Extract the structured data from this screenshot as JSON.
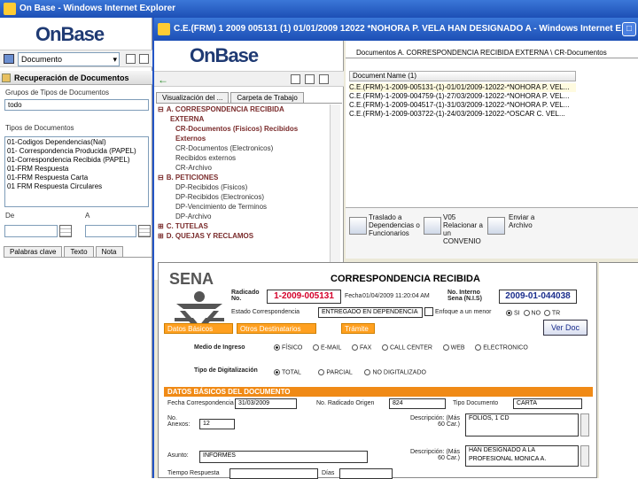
{
  "outer_window": {
    "title": "On Base - Windows Internet Explorer",
    "logo": "OnBase",
    "document_combo": "Documento",
    "panel_title": "Recuperación de Documentos",
    "groups_label": "Grupos de Tipos de Documentos",
    "groups_value": "todo",
    "types_label": "Tipos de Documentos",
    "types": [
      "01-Codigos Dependencias(Nal)",
      "01- Correspondencia Producida (PAPEL)",
      "01-Correspondencia Recibida (PAPEL)",
      "01-FRM Respuesta",
      "01-FRM Respuesta Carta",
      "01 FRM Respuesta Circulares"
    ],
    "date_from_label": "De",
    "date_to_label": "A",
    "tabs": [
      "Palabras clave",
      "Texto",
      "Nota"
    ]
  },
  "inner_window": {
    "title": "C.E.(FRM) 1 2009 005131 (1) 01/01/2009 12022 *NOHORA P. VELA HAN DESIGNADO A - Windows Internet E...",
    "logo": "OnBase",
    "nav_tabs": [
      "Visualización del ...",
      "Carpeta de Trabajo"
    ],
    "tree": [
      {
        "text": "A. CORRESPONDENCIA RECIBIDA",
        "bold": true,
        "toggle": "⊟"
      },
      {
        "text": "EXTERNA",
        "bold": true,
        "toggle": ""
      },
      {
        "text": "CR-Documentos (Fisicos) Recibidos",
        "bold": true,
        "toggle": "",
        "indent": 2
      },
      {
        "text": "Externos",
        "bold": true,
        "toggle": "",
        "indent": 2
      },
      {
        "text": "CR-Documentos (Electronicos)",
        "bold": false,
        "toggle": "",
        "indent": 2
      },
      {
        "text": "Recibidos externos",
        "bold": false,
        "toggle": "",
        "indent": 2
      },
      {
        "text": "CR-Archivo",
        "bold": false,
        "toggle": "",
        "indent": 2
      },
      {
        "text": "B. PETICIONES",
        "bold": true,
        "toggle": "⊟"
      },
      {
        "text": "DP-Recibidos (Fisicos)",
        "bold": false,
        "toggle": "",
        "indent": 2
      },
      {
        "text": "DP-Recibidos (Electronicos)",
        "bold": false,
        "toggle": "",
        "indent": 2
      },
      {
        "text": "DP-Vencimiento de Terminos",
        "bold": false,
        "toggle": "",
        "indent": 2
      },
      {
        "text": "DP-Archivo",
        "bold": false,
        "toggle": "",
        "indent": 2
      },
      {
        "text": "C. TUTELAS",
        "bold": true,
        "toggle": "⊞"
      },
      {
        "text": "D. QUEJAS Y RECLAMOS",
        "bold": true,
        "toggle": "⊞"
      }
    ],
    "documents_header": "Documentos A. CORRESPONDENCIA RECIBIDA EXTERNA \\ CR-Documentos",
    "documents_column": "Document Name (1)",
    "documents": [
      "C.E.(FRM)-1-2009-005131-(1)-01/01/2009-12022-*NOHORA P. VEL...",
      "C.E.(FRM)-1-2009-004759-(1)-27/03/2009-12022-*NOHORA P. VEL...",
      "C.E.(FRM)-1-2009-004517-(1)-31/03/2009-12022-*NOHORA P. VEL...",
      "C.E.(FRM)-1-2009-003722-(1)-24/03/2009-12022-*OSCAR C. VEL..."
    ],
    "actions": [
      "Traslado a Dependencias o Funcionarios",
      "V05 Relacionar a un CONVENIO",
      "Enviar a Archivo"
    ]
  },
  "form": {
    "org_logo": "SENA",
    "title": "CORRESPONDENCIA RECIBIDA",
    "radicado_label": "Radicado No.",
    "radicado_value": "1-2009-005131",
    "fecha_label": "Fecha",
    "fecha_value": "01/04/2009 11:20:04 AM",
    "sena_no_label": "No. Interno Sena (N.I.S)",
    "sena_no_value": "2009-01-044038",
    "estado_label": "Estado Correspondencia",
    "estado_value": "ENTREGADO EN DEPENDENCIA",
    "enfoque_label": "Enfoque a un menor",
    "radio_si": "SI",
    "radio_no": "NO",
    "radio_tr": "TR",
    "tab_basicos": "Datos Básicos",
    "tab_destinatarios": "Otros Destinatarios",
    "tab_tramite": "Trámite",
    "ver_doc": "Ver Doc",
    "medio_label": "Medio de Ingreso",
    "medios": [
      "FÍSICO",
      "E-MAIL",
      "FAX",
      "CALL CENTER",
      "WEB",
      "ELECTRONICO"
    ],
    "digit_label": "Tipo de Digitalización",
    "digits": [
      "TOTAL",
      "PARCIAL",
      "NO DIGITALIZADO"
    ],
    "section": "DATOS BÁSICOS DEL DOCUMENTO",
    "fecha_corr_label": "Fecha Correspondencia",
    "fecha_corr_value": "31/03/2009",
    "origen_label": "No. Radicado Origen",
    "origen_value": "824",
    "tipo_label": "Tipo Documento",
    "tipo_value": "CARTA",
    "anexos_label": "No. Anexos:",
    "anexos_value": "12",
    "desc1_label": "Descripción: (Más 60 Car.)",
    "desc1_value": "FOLIOS, 1 CD",
    "desc2_label": "Descripción: (Más 60 Car.)",
    "desc2_value": "HAN DESIGNADO A LA PROFESIONAL MONICA A.",
    "asunto_label": "Asunto:",
    "asunto_value": "INFORMES",
    "tiempo_label": "Tiempo Respuesta",
    "dias_label": "Días"
  }
}
